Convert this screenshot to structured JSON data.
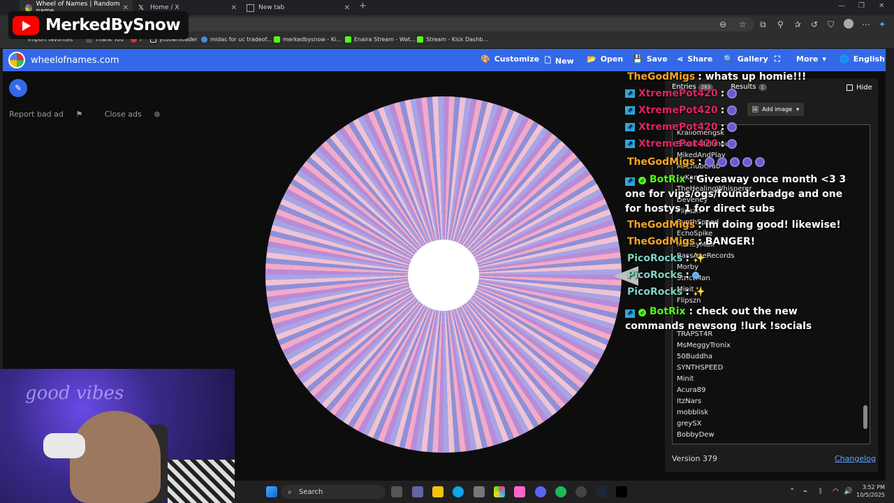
{
  "tabs": [
    {
      "label": "Wheel of Names | Random name"
    },
    {
      "label": "Home / X"
    },
    {
      "label": "New tab"
    }
  ],
  "favorites": [
    {
      "label": "Import favorites"
    },
    {
      "label": "Thank You"
    },
    {
      "label": "i"
    },
    {
      "label": "ytdownloader"
    },
    {
      "label": "midas for uc tradeof..."
    },
    {
      "label": "merkedbysnow - Ki..."
    },
    {
      "label": "Enaira Stream - Wat..."
    },
    {
      "label": "Stream - Kick Dashb..."
    }
  ],
  "overlay_logo": "MerkedBySnow",
  "site": {
    "brand": "wheelofnames.com",
    "nav": {
      "customize": "Customize",
      "new": "New",
      "open": "Open",
      "save": "Save",
      "share": "Share",
      "gallery": "Gallery",
      "more": "More",
      "language": "English"
    },
    "report_bad_ad": "Report bad ad",
    "close_ads": "Close ads"
  },
  "panel": {
    "entries_label": "Entries",
    "entries_count": "283",
    "results_label": "Results",
    "results_count": "1",
    "hide_label": "Hide",
    "add_image": "Add image",
    "entries": [
      "Kraliomengsk",
      "Shreif Mahmoud",
      "MikedAndPlay",
      "MrChubCrab",
      "LuKane",
      "TheHealingWhisperer",
      "Deveney",
      "Flipszn",
      "SynthSpeed",
      "EchoSpike",
      "MoneyMak",
      "BassApeRecords",
      "Morby",
      "StrictMan",
      "Minit",
      "Flipszn",
      "",
      "",
      "TRAPST4R",
      "MsMeggyTronix",
      "50Buddha",
      "SYNTHSPEED",
      "Minit",
      "Acura89",
      "ItzNars",
      "mobblisk",
      "greySX",
      "BobbyDew"
    ],
    "version": "Version 379",
    "changelog": "Changelog"
  },
  "chat": [
    {
      "user": "TheGodMigs",
      "color": "#f5a623",
      "msg": ": whats up homie!!!",
      "badge": "none"
    },
    {
      "user": "XtremePot420",
      "color": "#e0245e",
      "msg": ":",
      "badge": "kick"
    },
    {
      "user": "XtremePot420",
      "color": "#e0245e",
      "msg": ":",
      "badge": "kick"
    },
    {
      "user": "XtremePot420",
      "color": "#e0245e",
      "msg": ":",
      "badge": "kick"
    },
    {
      "user": "XtremePot420",
      "color": "#e0245e",
      "msg": ":",
      "badge": "kick"
    },
    {
      "user": "TheGodMigs",
      "color": "#f5a623",
      "msg": ":",
      "badge": "none"
    },
    {
      "user": "BotRix",
      "color": "#53fc18",
      "msg": ": Giveaway once month <3 3 one for vips/ogs/founderbadge and one for hostys 1 for direct subs",
      "badge": "kick-verified"
    },
    {
      "user": "TheGodMigs",
      "color": "#f5a623",
      "msg": ": im doing good! likewise!",
      "badge": "none"
    },
    {
      "user": "TheGodMigs",
      "color": "#f5a623",
      "msg": ": BANGER!",
      "badge": "none"
    },
    {
      "user": "PicoRocks",
      "color": "#7ed3c4",
      "msg": ":",
      "badge": "none"
    },
    {
      "user": "PicoRocks",
      "color": "#7ed3c4",
      "msg": ":",
      "badge": "none"
    },
    {
      "user": "PicoRocks",
      "color": "#7ed3c4",
      "msg": ":",
      "badge": "none"
    },
    {
      "user": "BotRix",
      "color": "#53fc18",
      "msg": ": check out the new commands newsong !lurk !socials",
      "badge": "kick-verified"
    }
  ],
  "webcam_sign": "good vibes",
  "taskbar": {
    "search": "Search",
    "time": "3:52 PM",
    "date": "10/5/2025"
  }
}
